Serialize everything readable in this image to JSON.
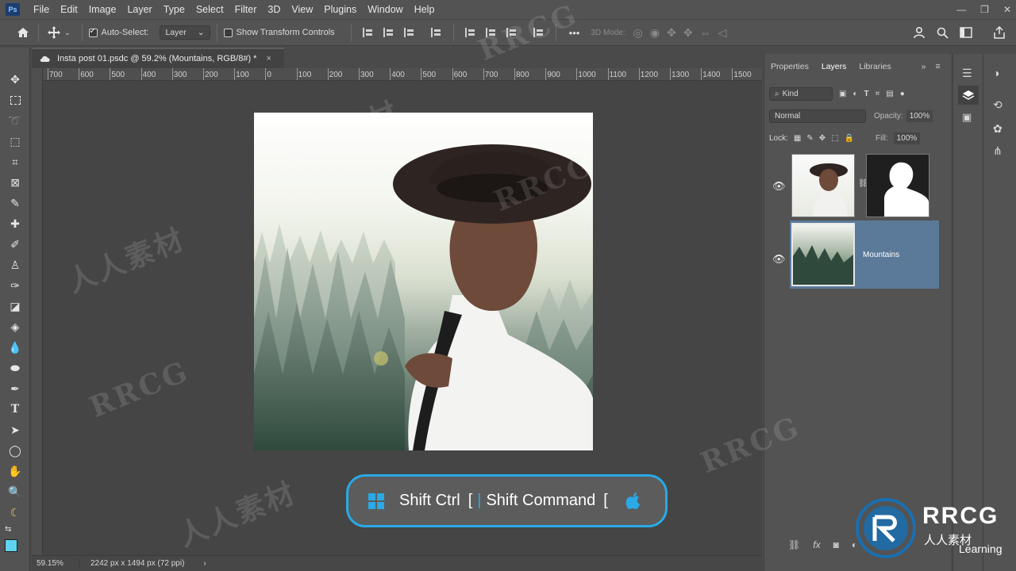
{
  "app": {
    "logo": "Ps"
  },
  "menu": [
    "File",
    "Edit",
    "Image",
    "Layer",
    "Type",
    "Select",
    "Filter",
    "3D",
    "View",
    "Plugins",
    "Window",
    "Help"
  ],
  "window_controls": [
    "—",
    "❐",
    "✕"
  ],
  "options_bar": {
    "auto_select_label": "Auto-Select:",
    "auto_select_value": "Layer",
    "show_transform_label": "Show Transform Controls",
    "mode_3d_label": "3D Mode:",
    "more": "•••"
  },
  "document": {
    "tab_title": "Insta post 01.psdc @ 59.2% (Mountains, RGB/8#) *",
    "close": "×"
  },
  "ruler": {
    "labels": [
      "700",
      "600",
      "500",
      "400",
      "300",
      "200",
      "100",
      "0",
      "100",
      "200",
      "300",
      "400",
      "500",
      "600",
      "700",
      "800",
      "900",
      "1000",
      "1100",
      "1200",
      "1300",
      "1400",
      "1500"
    ]
  },
  "status": {
    "zoom": "59.15%",
    "doc_size": "2242 px x 1494 px (72 ppi)",
    "arrow": "›"
  },
  "shortcut": {
    "windows_keys": "Shift Ctrl",
    "bracket1": "[",
    "divider": "|",
    "mac_keys": "Shift Command",
    "bracket2": "["
  },
  "panel": {
    "tabs": [
      "Properties",
      "Layers",
      "Libraries"
    ],
    "active_tab": "Layers",
    "filter_label": "Kind",
    "blend_mode": "Normal",
    "opacity_label": "Opacity:",
    "opacity_value": "100%",
    "lock_label": "Lock:",
    "fill_label": "Fill:",
    "fill_value": "100%",
    "layers": [
      {
        "name": "",
        "has_mask": true,
        "selected": false
      },
      {
        "name": "Mountains",
        "has_mask": false,
        "selected": true
      }
    ]
  },
  "watermark": {
    "brand": "RRCG",
    "sub": "人人素材",
    "partner": "Learning"
  },
  "colors": {
    "accent": "#29a9e6",
    "selected_layer": "#5b7a99",
    "foreground_swatch": "#5fd4f0",
    "background_swatch": "#ffffff"
  }
}
